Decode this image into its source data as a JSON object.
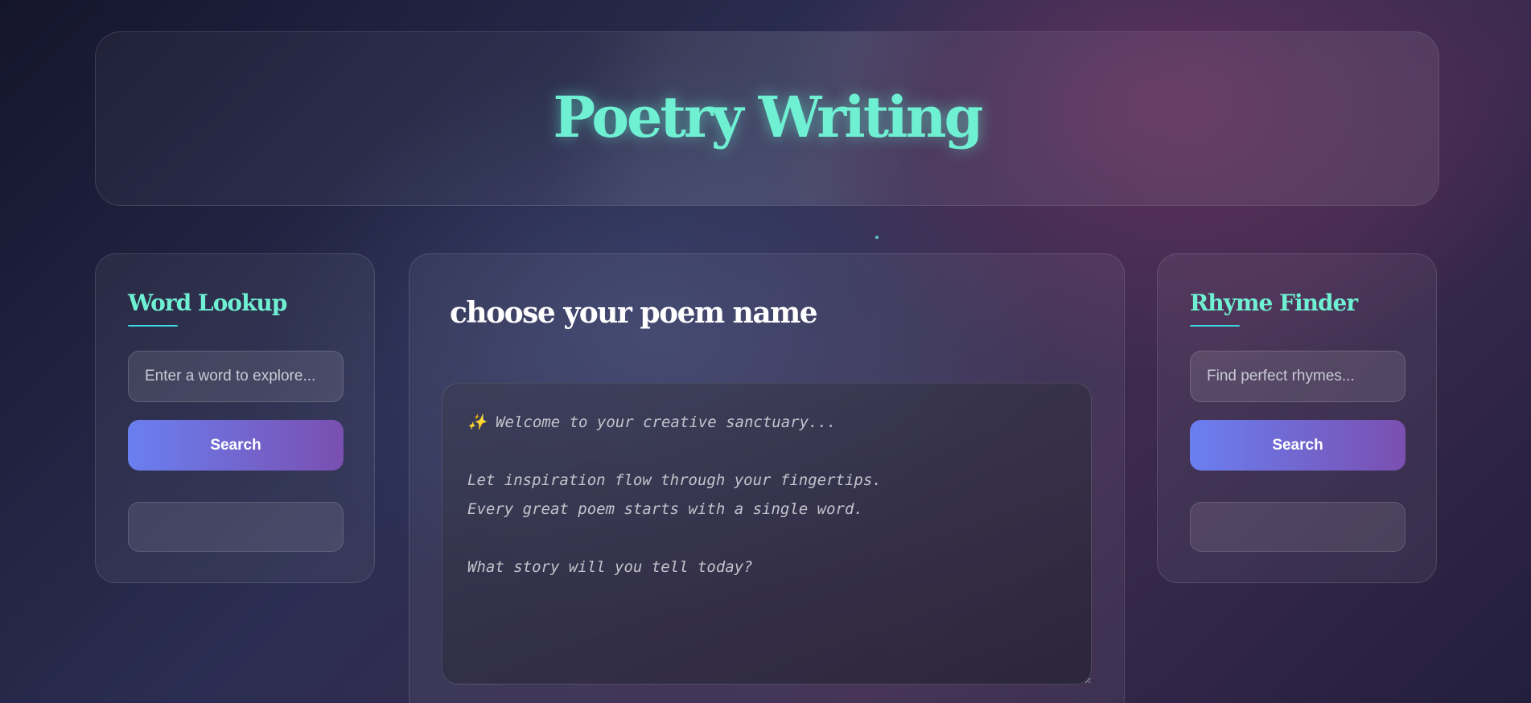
{
  "header": {
    "title": "Poetry Writing"
  },
  "word_lookup": {
    "title": "Word Lookup",
    "placeholder": "Enter a word to explore...",
    "button_label": "Search"
  },
  "rhyme_finder": {
    "title": "Rhyme Finder",
    "placeholder": "Find perfect rhymes...",
    "button_label": "Search"
  },
  "editor": {
    "poem_name": "choose your poem name",
    "placeholder": "✨ Welcome to your creative sanctuary...\n\nLet inspiration flow through your fingertips.\nEvery great poem starts with a single word.\n\nWhat story will you tell today?"
  },
  "colors": {
    "accent_title": "#6ff0d3",
    "button_gradient_start": "#6a7ff0",
    "button_gradient_end": "#7a4fb0"
  }
}
